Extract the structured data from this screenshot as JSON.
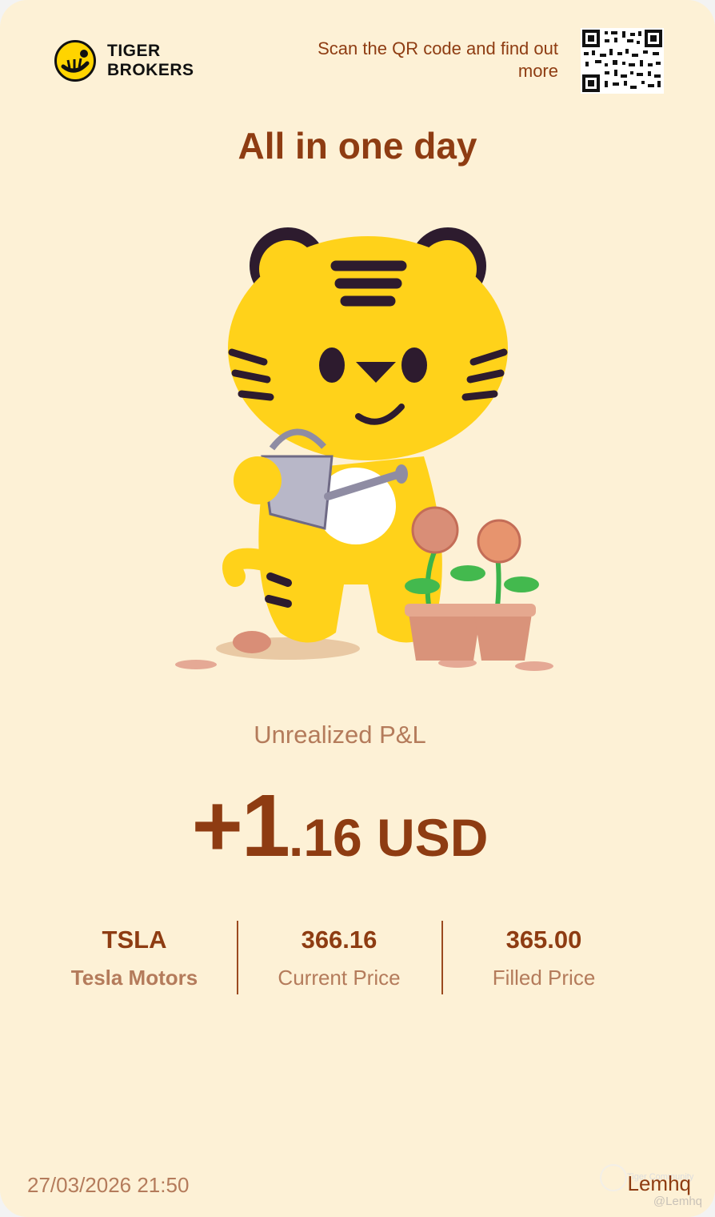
{
  "brand": {
    "line1": "TIGER",
    "line2": "BROKERS"
  },
  "qr": {
    "text": "Scan the QR code and find out more"
  },
  "title": "All in one day",
  "pl": {
    "label": "Unrealized P&L",
    "big": "+1",
    "rest": ".16 USD"
  },
  "stats": [
    {
      "main": "TSLA",
      "sub": "Tesla Motors"
    },
    {
      "main": "366.16",
      "sub": "Current Price"
    },
    {
      "main": "365.00",
      "sub": "Filled Price"
    }
  ],
  "footer": {
    "timestamp": "27/03/2026 21:50",
    "username": "Lemhq",
    "community": "Tiger Community",
    "watermark": "@Lemhq"
  },
  "colors": {
    "background": "#fdf1d6",
    "accent": "#8e3c12",
    "muted": "#b47b5b",
    "tiger": "#ffd400"
  },
  "icons": {
    "logo": "tiger-logo-icon",
    "qr": "qr-code-icon",
    "mascot": "tiger-mascot-illustration"
  }
}
